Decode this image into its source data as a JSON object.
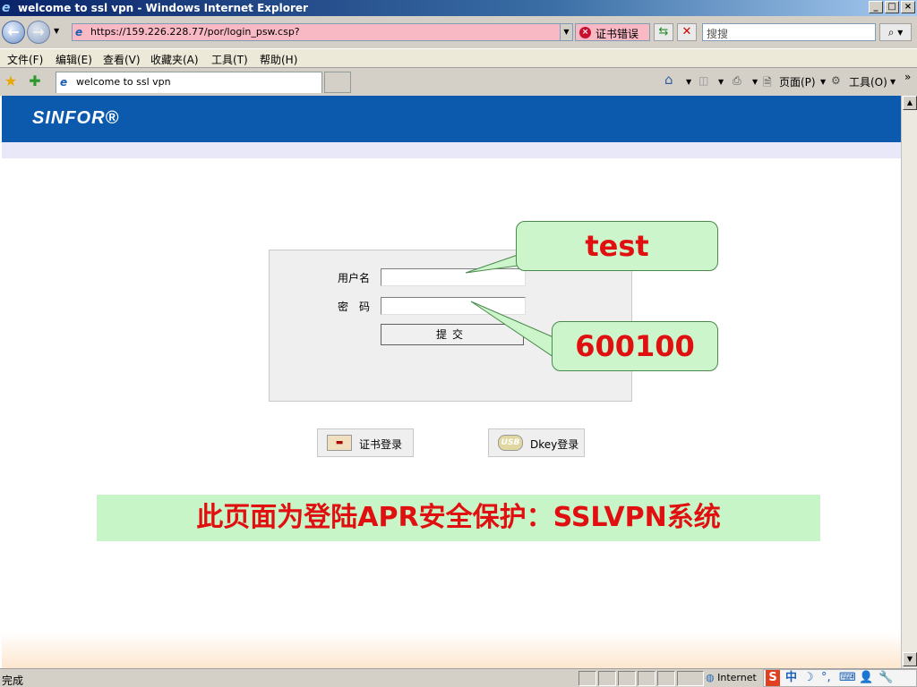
{
  "window": {
    "title": "welcome to ssl vpn - Windows Internet Explorer",
    "min_label": "_",
    "max_label": "□",
    "close_label": "×"
  },
  "address": {
    "url": "https://159.226.228.77/por/login_psw.csp?",
    "cert_error": "证书错误",
    "search_placeholder": "搜搜"
  },
  "menu": {
    "items": [
      "文件(F)",
      "编辑(E)",
      "查看(V)",
      "收藏夹(A)",
      "工具(T)",
      "帮助(H)"
    ]
  },
  "tabs": {
    "active_label": "welcome to ssl vpn"
  },
  "command_bar": {
    "page_label": "页面(P)",
    "tools_label": "工具(O)"
  },
  "banner": {
    "logo": "SINFOR®"
  },
  "login": {
    "username_label": "用户名",
    "password_label": "密　码",
    "submit_label": "提交"
  },
  "alt_logins": {
    "cert_label": "证书登录",
    "dkey_label": "Dkey登录",
    "usb_label": "USB"
  },
  "notice": "此页面为登陆APR安全保护：SSLVPN系统",
  "callouts": {
    "username_value": "test",
    "password_value": "600100"
  },
  "status": {
    "text": "完成",
    "zone": "Internet",
    "ime_brand": "S",
    "ime_lang": "中"
  },
  "colors": {
    "banner": "#0b5aae",
    "notice_bg": "#c8f5c8",
    "notice_text": "#e01010",
    "address_error_bg": "#f8b8c4"
  }
}
